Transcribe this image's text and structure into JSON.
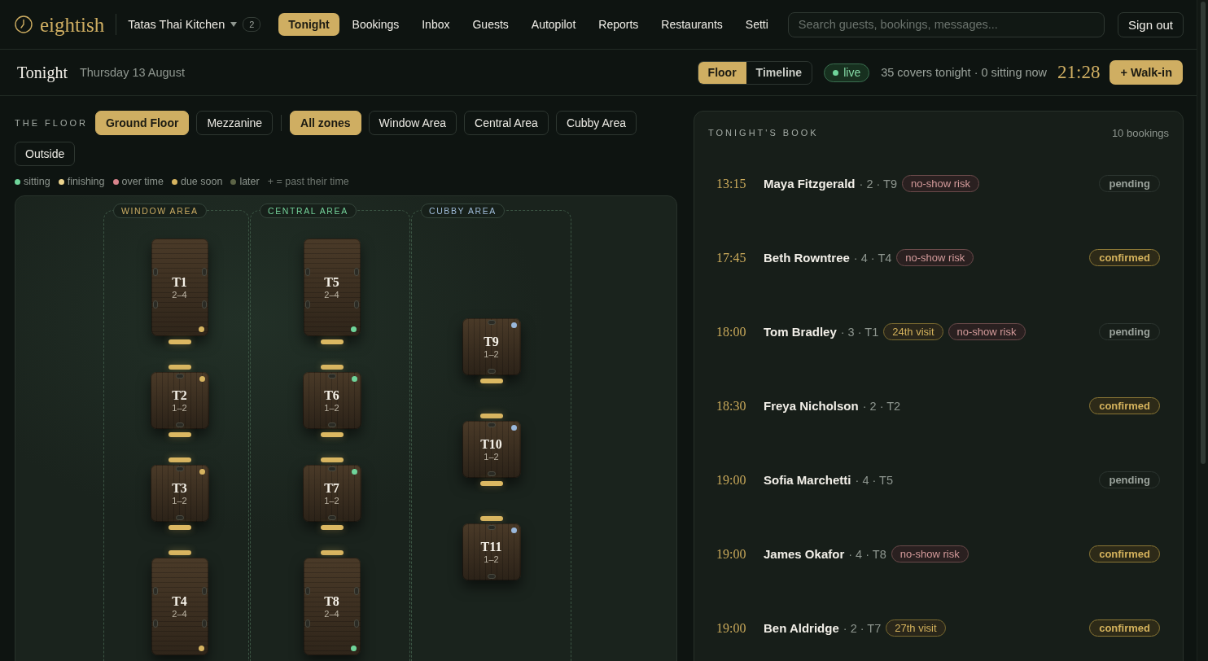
{
  "brand": {
    "name": "eightish"
  },
  "restaurant": {
    "name": "Tatas Thai Kitchen",
    "count": "2"
  },
  "nav": [
    {
      "label": "Tonight",
      "selected": true
    },
    {
      "label": "Bookings",
      "selected": false
    },
    {
      "label": "Inbox",
      "selected": false
    },
    {
      "label": "Guests",
      "selected": false
    },
    {
      "label": "Autopilot",
      "selected": false
    },
    {
      "label": "Reports",
      "selected": false
    },
    {
      "label": "Restaurants",
      "selected": false
    },
    {
      "label": "Setti",
      "selected": false
    }
  ],
  "search": {
    "placeholder": "Search guests, bookings, messages..."
  },
  "sign_out": {
    "label": "Sign out"
  },
  "page": {
    "title": "Tonight",
    "date": "Thursday 13 August"
  },
  "view_toggle": [
    {
      "label": "Floor",
      "selected": true
    },
    {
      "label": "Timeline",
      "selected": false
    }
  ],
  "live": {
    "label": "live"
  },
  "summary": "35 covers tonight · 0 sitting now",
  "clock": "21:28",
  "walk_in": {
    "label": "+ Walk-in"
  },
  "floor": {
    "heading": "THE FLOOR",
    "floors": [
      {
        "label": "Ground Floor",
        "selected": true
      },
      {
        "label": "Mezzanine",
        "selected": false
      }
    ],
    "zone_filters": [
      {
        "label": "All zones",
        "selected": true
      },
      {
        "label": "Window Area",
        "selected": false
      },
      {
        "label": "Central Area",
        "selected": false
      },
      {
        "label": "Cubby Area",
        "selected": false
      },
      {
        "label": "Outside",
        "selected": false
      }
    ],
    "legend": [
      {
        "label": "sitting",
        "color": "#6fd49a"
      },
      {
        "label": "finishing",
        "color": "#ecd48e"
      },
      {
        "label": "over time",
        "color": "#d9848c"
      },
      {
        "label": "due soon",
        "color": "#d6b460"
      },
      {
        "label": "later",
        "color": "#5c6446"
      }
    ],
    "legend_note": "+ = past their time",
    "zones": [
      {
        "label": "WINDOW AREA",
        "color": "#c9aa62",
        "tables": [
          {
            "kind": "long",
            "name": "T1",
            "capacity": "2–4",
            "color": "#d6b460",
            "seat_above": false,
            "seat_below": true
          },
          {
            "kind": "square",
            "name": "T2",
            "capacity": "1–2",
            "color": "#d6b460",
            "seat_above": true,
            "seat_below": true
          },
          {
            "kind": "square",
            "name": "T3",
            "capacity": "1–2",
            "color": "#d6b460",
            "seat_above": true,
            "seat_below": true
          },
          {
            "kind": "long",
            "name": "T4",
            "capacity": "2–4",
            "color": "#d6b460",
            "seat_above": true,
            "seat_below": false
          }
        ]
      },
      {
        "label": "CENTRAL AREA",
        "color": "#72cf98",
        "tables": [
          {
            "kind": "long",
            "name": "T5",
            "capacity": "2–4",
            "color": "#6fd49a",
            "seat_above": false,
            "seat_below": true
          },
          {
            "kind": "square",
            "name": "T6",
            "capacity": "1–2",
            "color": "#6fd49a",
            "seat_above": true,
            "seat_below": true
          },
          {
            "kind": "square",
            "name": "T7",
            "capacity": "1–2",
            "color": "#6fd49a",
            "seat_above": true,
            "seat_below": true
          },
          {
            "kind": "long",
            "name": "T8",
            "capacity": "2–4",
            "color": "#6fd49a",
            "seat_above": true,
            "seat_below": false
          }
        ]
      },
      {
        "label": "CUBBY AREA",
        "color": "#9db9d6",
        "tables": [
          {
            "kind": "square",
            "name": "T9",
            "capacity": "1–2",
            "color": "#9ab8dc",
            "seat_above": false,
            "seat_below": true
          },
          {
            "kind": "square",
            "name": "T10",
            "capacity": "1–2",
            "color": "#9ab8dc",
            "seat_above": true,
            "seat_below": true
          },
          {
            "kind": "square",
            "name": "T11",
            "capacity": "1–2",
            "color": "#9ab8dc",
            "seat_above": true,
            "seat_below": false
          }
        ]
      }
    ]
  },
  "book": {
    "heading": "TONIGHT'S BOOK",
    "count": "10 bookings",
    "bookings": [
      {
        "time": "13:15",
        "name": "Maya Fitzgerald",
        "details": "· 2 · T9",
        "tags": [
          {
            "kind": "risk",
            "label": "no-show risk"
          }
        ],
        "status": "pending",
        "confirmed": false
      },
      {
        "time": "17:45",
        "name": "Beth Rowntree",
        "details": "· 4 · T4",
        "tags": [
          {
            "kind": "risk",
            "label": "no-show risk"
          }
        ],
        "status": "confirmed",
        "confirmed": true
      },
      {
        "time": "18:00",
        "name": "Tom Bradley",
        "details": "· 3 · T1",
        "tags": [
          {
            "kind": "visit",
            "label": "24th visit"
          },
          {
            "kind": "risk",
            "label": "no-show risk"
          }
        ],
        "status": "pending",
        "confirmed": false
      },
      {
        "time": "18:30",
        "name": "Freya Nicholson",
        "details": "· 2 · T2",
        "status": "confirmed",
        "confirmed": true
      },
      {
        "time": "19:00",
        "name": "Sofia Marchetti",
        "details": "· 4 · T5",
        "status": "pending",
        "confirmed": false
      },
      {
        "time": "19:00",
        "name": "James Okafor",
        "details": "· 4 · T8",
        "tags": [
          {
            "kind": "risk",
            "label": "no-show risk"
          }
        ],
        "status": "confirmed",
        "confirmed": true
      },
      {
        "time": "19:00",
        "name": "Ben Aldridge",
        "details": "· 2 · T7",
        "tags": [
          {
            "kind": "visit",
            "label": "27th visit"
          }
        ],
        "status": "confirmed",
        "confirmed": true
      }
    ]
  }
}
